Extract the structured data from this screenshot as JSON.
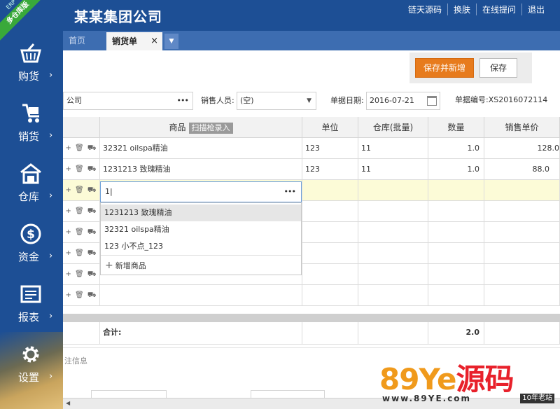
{
  "header": {
    "company": "某某集团公司",
    "links": [
      "链天源码",
      "换肤",
      "在线提问",
      "退出"
    ]
  },
  "sidebar": {
    "ribbon": "多仓库版",
    "erp": "ERP",
    "items": [
      {
        "label": "购货",
        "icon": "basket-icon"
      },
      {
        "label": "销货",
        "icon": "cart-icon"
      },
      {
        "label": "仓库",
        "icon": "warehouse-icon"
      },
      {
        "label": "资金",
        "icon": "money-icon"
      },
      {
        "label": "报表",
        "icon": "report-icon"
      },
      {
        "label": "设置",
        "icon": "gear-icon"
      }
    ]
  },
  "tabs": {
    "home": "首页",
    "active": "销货单",
    "close": "×",
    "more": "▼"
  },
  "toolbar": {
    "save_new": "保存并新增",
    "save": "保存"
  },
  "form": {
    "customer": "公司",
    "salesperson_label": "销售人员:",
    "salesperson_value": "(空)",
    "date_label": "单据日期:",
    "date_value": "2016-07-21",
    "billno_label": "单据编号:",
    "billno_value": "XS2016072114"
  },
  "grid": {
    "headers": {
      "product": "商品",
      "scan": "扫描枪录入",
      "unit": "单位",
      "warehouse": "仓库(批量)",
      "qty": "数量",
      "price": "销售单价"
    },
    "ops": "+ 🗑 ⛟",
    "rows": [
      {
        "product": "32321 oilspa精油",
        "unit": "123",
        "warehouse": "11",
        "qty": "1.0",
        "price": "128.0"
      },
      {
        "product": "1231213 致瑰精油",
        "unit": "123",
        "warehouse": "11",
        "qty": "1.0",
        "price": "88.0"
      }
    ],
    "editing_value": "1|",
    "total_label": "合计:",
    "total_qty": "2.0"
  },
  "dropdown": {
    "items": [
      "1231213 致瑰精油",
      "32321 oilspa精油",
      "123 小不点_123"
    ],
    "add_label": "新增商品"
  },
  "note_label": "注信息",
  "watermark": {
    "main_a": "89Ye",
    "main_b": "源码",
    "sub": "www.89YE.com",
    "badge": "10年老站"
  },
  "colors": {
    "brand": "#1d4f95",
    "accent": "#e77b1d",
    "highlight_row": "#fcfbd7"
  }
}
